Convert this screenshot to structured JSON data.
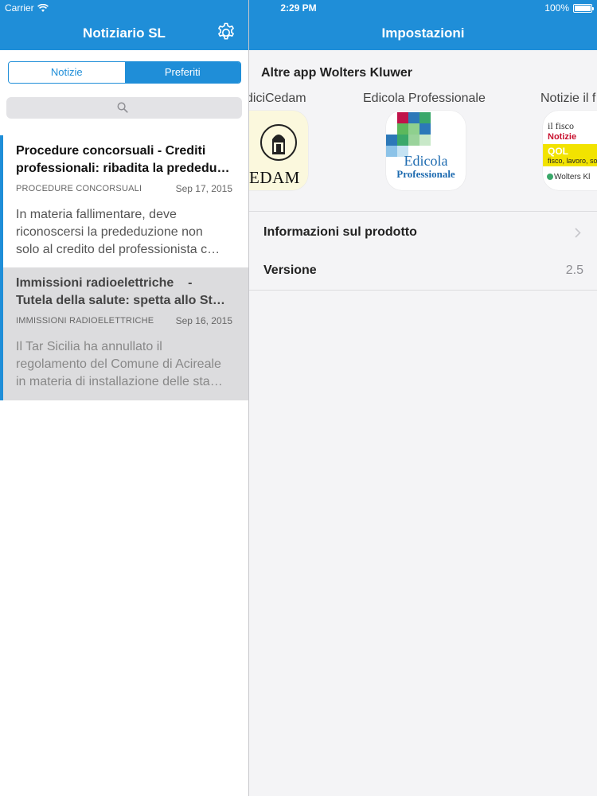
{
  "status": {
    "carrier": "Carrier",
    "time": "2:29 PM",
    "battery": "100%"
  },
  "left_nav": {
    "title": "Notiziario SL"
  },
  "right_nav": {
    "title": "Impostazioni"
  },
  "segments": [
    {
      "label": "Notizie",
      "selected": false
    },
    {
      "label": "Preferiti",
      "selected": true
    }
  ],
  "articles": [
    {
      "title_line1": "Procedure concorsuali - Crediti",
      "title_line2": "professionali: ribadita la prededu…",
      "category": "PROCEDURE CONCORSUALI",
      "date": "Sep 17, 2015",
      "summary_line1": "In materia fallimentare, deve",
      "summary_line2": "riconoscersi la prededuzione non",
      "summary_line3": "solo al credito del professionista c…"
    },
    {
      "title_line1": "Immissioni radioelettriche    -",
      "title_line2": "Tutela della salute: spetta allo St…",
      "category": "IMMISSIONI RADIOELETTRICHE",
      "date": "Sep 16, 2015",
      "summary_line1": "Il Tar Sicilia ha annullato il",
      "summary_line2": "regolamento del Comune di Acireale",
      "summary_line3": "in materia di installazione delle sta…"
    }
  ],
  "settings": {
    "apps_header": "Altre app Wolters Kluwer",
    "apps": [
      {
        "name": "diciCedam",
        "icon_text": "EDAM"
      },
      {
        "name": "Edicola Professionale",
        "icon_line1": "Edicola",
        "icon_line2": "Professionale"
      },
      {
        "name": "Notizie il f",
        "icon_line1": "il fisco",
        "icon_line2": "Notizie",
        "icon_line3": "QOL",
        "icon_line4": "fisco, lavoro, so",
        "icon_line5": "Wolters Kl"
      }
    ],
    "rows": [
      {
        "label": "Informazioni sul prodotto",
        "value": ""
      },
      {
        "label": "Versione",
        "value": "2.5"
      }
    ]
  },
  "colors": {
    "brand_blue": "#1f8ed8",
    "gray_bg": "#f4f4f6"
  }
}
